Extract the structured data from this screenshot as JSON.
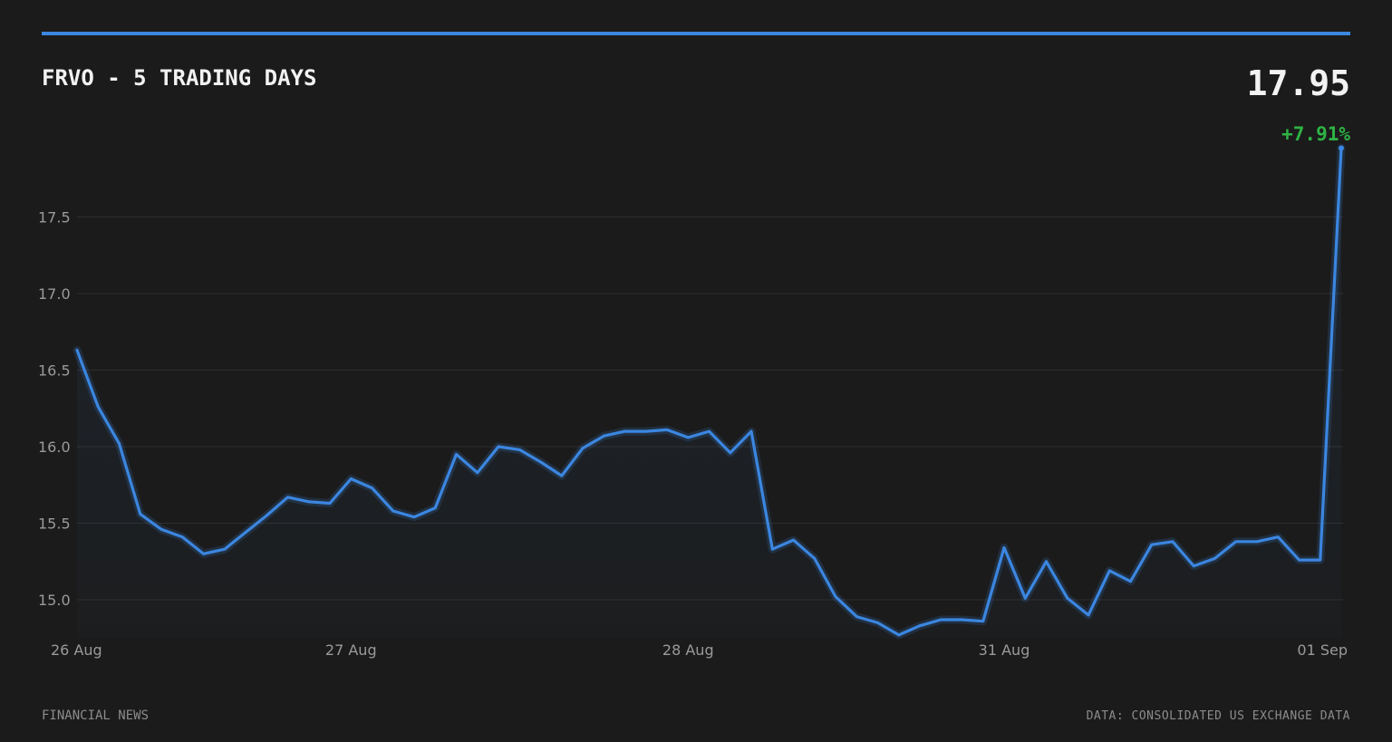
{
  "header": {
    "title": "FRVO - 5 TRADING DAYS",
    "price": "17.95",
    "change": "+7.91%"
  },
  "footer": {
    "left": "FINANCIAL NEWS",
    "right": "DATA: CONSOLIDATED US EXCHANGE DATA"
  },
  "colors": {
    "background": "#1b1b1b",
    "line": "#3b86e0",
    "positive": "#2fb344",
    "grid": "#2e2e2e",
    "text": "#f2f2f2",
    "muted": "#9a9a9a"
  },
  "chart_data": {
    "type": "line",
    "title": "FRVO - 5 TRADING DAYS",
    "xlabel": "",
    "ylabel": "",
    "grid": true,
    "ylim": [
      14.75,
      18.0
    ],
    "y_ticks": [
      "15.0",
      "15.5",
      "16.0",
      "16.5",
      "17.0",
      "17.5"
    ],
    "x_ticks": [
      {
        "label": "26 Aug",
        "index": 0
      },
      {
        "label": "27 Aug",
        "index": 13
      },
      {
        "label": "28 Aug",
        "index": 29
      },
      {
        "label": "31 Aug",
        "index": 44
      },
      {
        "label": "01 Sep",
        "index": 60
      }
    ],
    "series": [
      {
        "values": [
          16.63,
          16.26,
          16.02,
          15.56,
          15.46,
          15.41,
          15.3,
          15.33,
          15.44,
          15.55,
          15.67,
          15.64,
          15.63,
          15.79,
          15.73,
          15.58,
          15.54,
          15.6,
          15.95,
          15.83,
          16.0,
          15.98,
          15.9,
          15.81,
          15.99,
          16.07,
          16.1,
          16.1,
          16.11,
          16.06,
          16.1,
          15.96,
          16.1,
          15.33,
          15.39,
          15.27,
          15.02,
          14.89,
          14.85,
          14.77,
          14.83,
          14.87,
          14.87,
          14.86,
          15.34,
          15.01,
          15.25,
          15.01,
          14.9,
          15.19,
          15.12,
          15.36,
          15.38,
          15.22,
          15.27,
          15.38,
          15.38,
          15.41,
          15.26,
          15.26,
          17.95
        ]
      }
    ]
  }
}
